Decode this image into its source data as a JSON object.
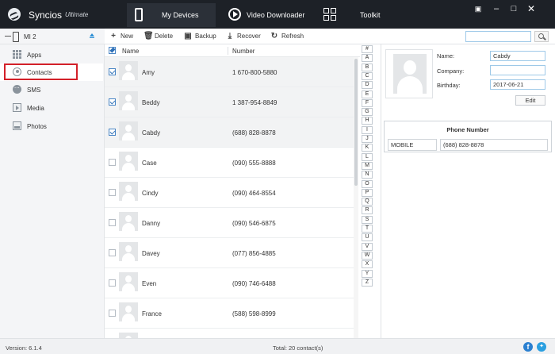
{
  "app": {
    "name": "Syncios",
    "edition": "Ultimate"
  },
  "tabs": [
    {
      "label": "My Devices",
      "icon": "phone-icon",
      "active": true
    },
    {
      "label": "Video Downloader",
      "icon": "play-icon",
      "active": false
    },
    {
      "label": "Toolkit",
      "icon": "grid-icon",
      "active": false
    }
  ],
  "window_controls": [
    "menu-icon",
    "minimize-icon",
    "maximize-icon",
    "close-icon"
  ],
  "device": {
    "name": "MI 2"
  },
  "toolbar": {
    "new": "New",
    "delete": "Delete",
    "backup": "Backup",
    "recover": "Recover",
    "refresh": "Refresh",
    "search_value": ""
  },
  "sidebar": {
    "items": [
      {
        "label": "Apps",
        "icon": "apps-icon"
      },
      {
        "label": "Contacts",
        "icon": "contact-icon",
        "active": true
      },
      {
        "label": "SMS",
        "icon": "sms-icon"
      },
      {
        "label": "Media",
        "icon": "media-icon"
      },
      {
        "label": "Photos",
        "icon": "photos-icon"
      }
    ]
  },
  "contacts": {
    "columns": {
      "name": "Name",
      "number": "Number"
    },
    "rows": [
      {
        "name": "Amy",
        "number": "1 670-800-5880",
        "checked": true
      },
      {
        "name": "Beddy",
        "number": "1 387-954-8849",
        "checked": true
      },
      {
        "name": "Cabdy",
        "number": "(688) 828-8878",
        "checked": true
      },
      {
        "name": "Case",
        "number": "(090) 555-8888",
        "checked": false
      },
      {
        "name": "Cindy",
        "number": "(090) 464-8554",
        "checked": false
      },
      {
        "name": "Danny",
        "number": "(090) 546-6875",
        "checked": false
      },
      {
        "name": "Davey",
        "number": "(077) 856-4885",
        "checked": false
      },
      {
        "name": "Even",
        "number": "(090) 746-6488",
        "checked": false
      },
      {
        "name": "France",
        "number": "(588) 598-8999",
        "checked": false
      }
    ]
  },
  "alphabet": [
    "#",
    "A",
    "B",
    "C",
    "D",
    "E",
    "F",
    "G",
    "H",
    "I",
    "J",
    "K",
    "L",
    "M",
    "N",
    "O",
    "P",
    "Q",
    "R",
    "S",
    "T",
    "U",
    "V",
    "W",
    "X",
    "Y",
    "Z"
  ],
  "detail": {
    "name_label": "Name:",
    "name_value": "Cabdy",
    "company_label": "Company:",
    "company_value": "",
    "birthday_label": "Birthday:",
    "birthday_value": "2017-06-21",
    "edit_label": "Edit",
    "phone_title": "Phone Number",
    "phone_type": "MOBILE",
    "phone_value": "(688) 828-8878"
  },
  "status": {
    "version": "Version: 6.1.4",
    "total": "Total: 20 contact(s)"
  },
  "colors": {
    "titlebar": "#1d2127",
    "accent": "#2a8dd4",
    "highlight": "#d32029"
  }
}
